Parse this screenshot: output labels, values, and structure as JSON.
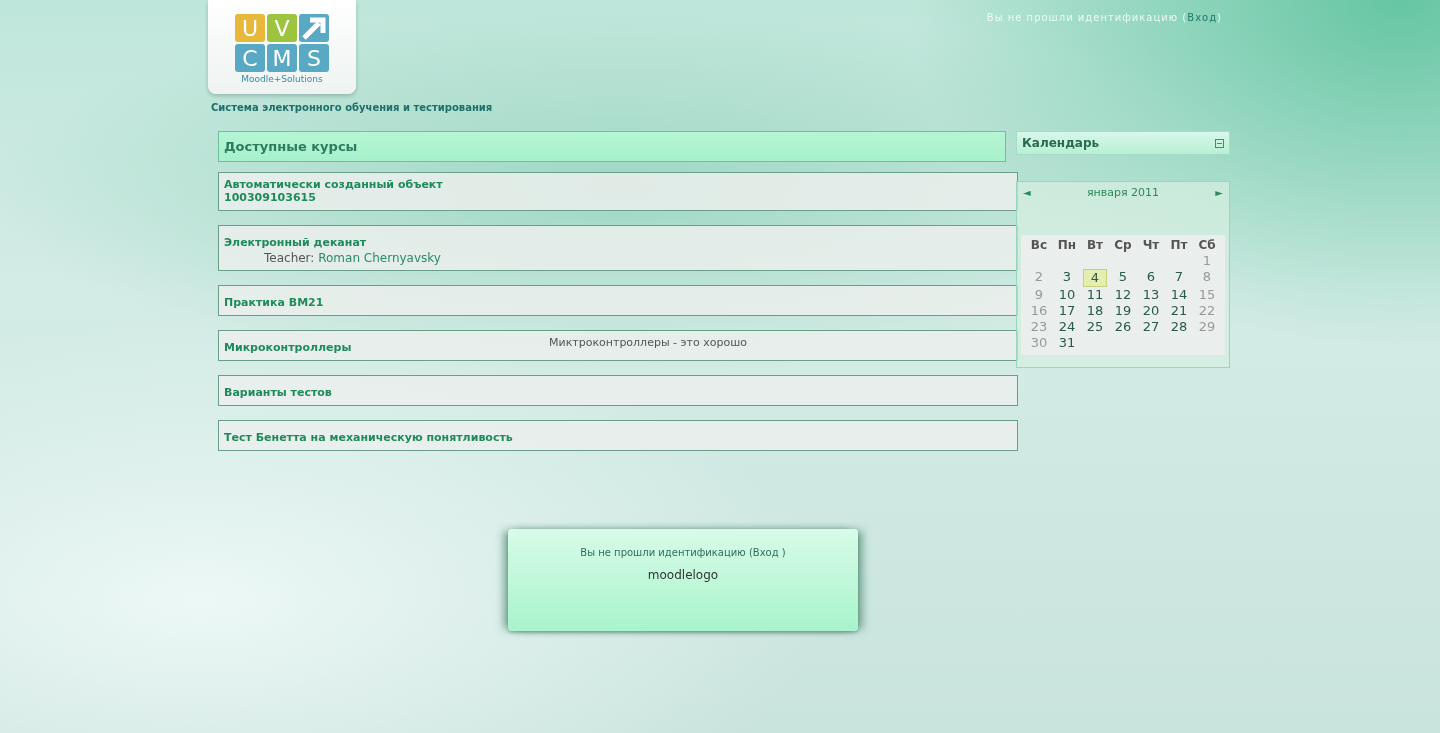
{
  "header": {
    "logo": {
      "letters": [
        "U",
        "V",
        "C",
        "M",
        "S"
      ],
      "subtitle": "Moodle+Solutions"
    },
    "tagline": "Система электронного обучения и тестирования",
    "login_info": {
      "prefix": "Вы не прошли идентификацию (",
      "link": "Вход",
      "suffix": ")"
    }
  },
  "courses": {
    "title": "Доступные курсы",
    "items": [
      {
        "name": "Автоматически созданный объект\n100309103615"
      },
      {
        "name": "Электронный деканат",
        "teacher_label": "Teacher: ",
        "teacher": "Roman Chernyavsky"
      },
      {
        "name": "Практика ВМ21"
      },
      {
        "name": "Микроконтроллеры",
        "summary": "Миктроконтроллеры - это хорошо"
      },
      {
        "name": "Варианты тестов"
      },
      {
        "name": "Тест Бенетта на механическую понятливость"
      }
    ]
  },
  "calendar": {
    "title": "Календарь",
    "prev": "◄",
    "next": "►",
    "month": "января 2011",
    "weekdays": [
      "Вс",
      "Пн",
      "Вт",
      "Ср",
      "Чт",
      "Пт",
      "Сб"
    ],
    "weeks": [
      {
        "kind": "tail",
        "days": [
          {
            "label": "1",
            "weekend": true,
            "today": false
          }
        ]
      },
      {
        "kind": "full",
        "days": [
          {
            "label": "2",
            "weekend": true,
            "today": false
          },
          {
            "label": "3",
            "weekend": false,
            "today": false
          },
          {
            "label": "4",
            "weekend": false,
            "today": true
          },
          {
            "label": "5",
            "weekend": false,
            "today": false
          },
          {
            "label": "6",
            "weekend": false,
            "today": false
          },
          {
            "label": "7",
            "weekend": false,
            "today": false
          },
          {
            "label": "8",
            "weekend": true,
            "today": false
          }
        ]
      },
      {
        "kind": "full",
        "days": [
          {
            "label": "9",
            "weekend": true,
            "today": false
          },
          {
            "label": "10",
            "weekend": false,
            "today": false
          },
          {
            "label": "11",
            "weekend": false,
            "today": false
          },
          {
            "label": "12",
            "weekend": false,
            "today": false
          },
          {
            "label": "13",
            "weekend": false,
            "today": false
          },
          {
            "label": "14",
            "weekend": false,
            "today": false
          },
          {
            "label": "15",
            "weekend": true,
            "today": false
          }
        ]
      },
      {
        "kind": "full",
        "days": [
          {
            "label": "16",
            "weekend": true,
            "today": false
          },
          {
            "label": "17",
            "weekend": false,
            "today": false
          },
          {
            "label": "18",
            "weekend": false,
            "today": false
          },
          {
            "label": "19",
            "weekend": false,
            "today": false
          },
          {
            "label": "20",
            "weekend": false,
            "today": false
          },
          {
            "label": "21",
            "weekend": false,
            "today": false
          },
          {
            "label": "22",
            "weekend": true,
            "today": false
          }
        ]
      },
      {
        "kind": "full",
        "days": [
          {
            "label": "23",
            "weekend": true,
            "today": false
          },
          {
            "label": "24",
            "weekend": false,
            "today": false
          },
          {
            "label": "25",
            "weekend": false,
            "today": false
          },
          {
            "label": "26",
            "weekend": false,
            "today": false
          },
          {
            "label": "27",
            "weekend": false,
            "today": false
          },
          {
            "label": "28",
            "weekend": false,
            "today": false
          },
          {
            "label": "29",
            "weekend": true,
            "today": false
          }
        ]
      },
      {
        "kind": "full",
        "days": [
          {
            "label": "30",
            "weekend": true,
            "today": false
          },
          {
            "label": "31",
            "weekend": false,
            "today": false
          }
        ]
      }
    ]
  },
  "footer": {
    "login_info": "Вы не прошли идентификацию (Вход  )",
    "logo_alt": "moodlelogo"
  }
}
